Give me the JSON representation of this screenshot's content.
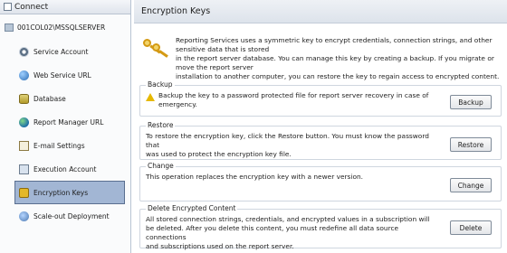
{
  "connect": {
    "label": "Connect"
  },
  "server": {
    "name": "001COL02\\MSSQLSERVER"
  },
  "nav": {
    "items": [
      {
        "label": "Service Account"
      },
      {
        "label": "Web Service URL"
      },
      {
        "label": "Database"
      },
      {
        "label": "Report Manager URL"
      },
      {
        "label": "E-mail Settings"
      },
      {
        "label": "Execution Account"
      },
      {
        "label": "Encryption Keys"
      },
      {
        "label": "Scale-out Deployment"
      }
    ],
    "selected": "Encryption Keys"
  },
  "page": {
    "title": "Encryption Keys",
    "intro": "Reporting Services uses a symmetric key to encrypt credentials, connection strings, and other sensitive data that is stored\nin the report server database.  You can manage this key by creating a backup.  If you migrate or move the report server\ninstallation to another computer, you can restore the key to regain access to encrypted content."
  },
  "sections": {
    "backup": {
      "title": "Backup",
      "text": "Backup the key to a password protected file for report server recovery in case of\nemergency.",
      "button": "Backup"
    },
    "restore": {
      "title": "Restore",
      "text": "To restore the encryption key, click the Restore button.  You must know the password that\nwas used to protect the encryption key file.",
      "button": "Restore"
    },
    "change": {
      "title": "Change",
      "text": "This operation replaces the encryption key with a newer version.",
      "button": "Change"
    },
    "delete": {
      "title": "Delete Encrypted Content",
      "text": "All stored connection strings, credentials, and encrypted values in a subscription will\nbe deleted.  After you delete this content, you must redefine all data source connections\nand subscriptions used on the report server.",
      "button": "Delete"
    }
  }
}
